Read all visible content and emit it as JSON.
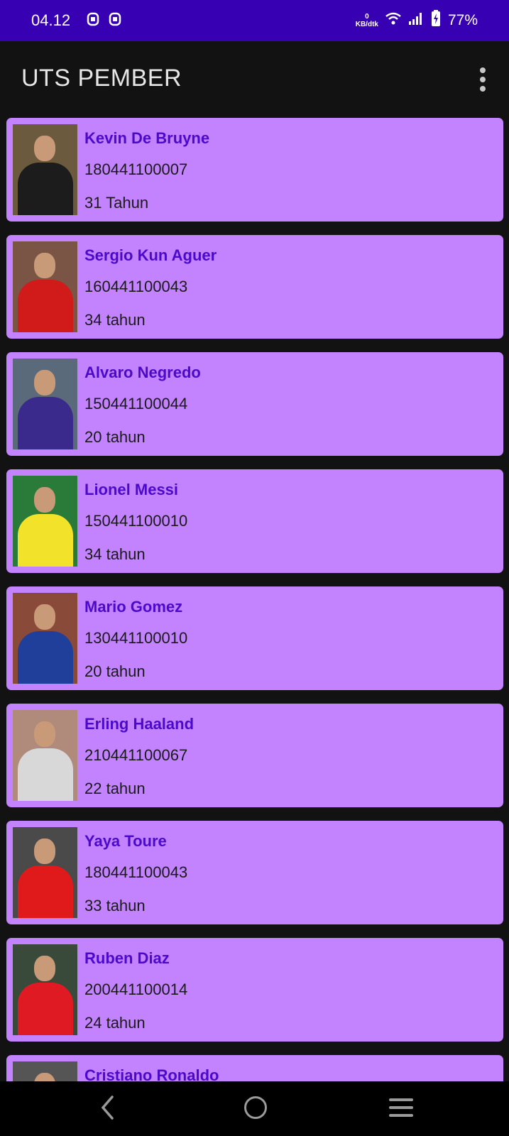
{
  "status_bar": {
    "time": "04.12",
    "notification_icons": [
      "notification-app-icon",
      "notification-app-icon"
    ],
    "network_speed_value": "0",
    "network_speed_unit": "KB/dtk",
    "battery": "77%",
    "bg_color": "#3700B3"
  },
  "app_bar": {
    "title": "UTS PEMBER",
    "menu_icon": "overflow-menu-icon"
  },
  "colors": {
    "card_bg": "#C383FE",
    "name_color": "#4B0ACB",
    "app_bg": "#121212"
  },
  "players": [
    {
      "name": "Kevin De Bruyne",
      "nim": "180441100007",
      "age": "31 Tahun",
      "kit": "#1c1c1c",
      "bg": "#6b5a3e"
    },
    {
      "name": "Sergio Kun Aguer",
      "nim": "160441100043",
      "age": "34 tahun",
      "kit": "#d11a1a",
      "bg": "#7a5545"
    },
    {
      "name": "Alvaro Negredo",
      "nim": "150441100044",
      "age": "20 tahun",
      "kit": "#3a2a8c",
      "bg": "#5a6a7a"
    },
    {
      "name": "Lionel Messi",
      "nim": "150441100010",
      "age": "34 tahun",
      "kit": "#f2e22a",
      "bg": "#2a7a3a"
    },
    {
      "name": "Mario Gomez",
      "nim": "130441100010",
      "age": "20 tahun",
      "kit": "#1f3f9a",
      "bg": "#8a4a3a"
    },
    {
      "name": "Erling Haaland",
      "nim": "210441100067",
      "age": "22 tahun",
      "kit": "#d8d8d8",
      "bg": "#b08a7a"
    },
    {
      "name": "Yaya Toure",
      "nim": "180441100043",
      "age": "33 tahun",
      "kit": "#e01a1a",
      "bg": "#4a4a4a"
    },
    {
      "name": "Ruben Diaz",
      "nim": "200441100014",
      "age": "24 tahun",
      "kit": "#e01a22",
      "bg": "#3a4a3a"
    },
    {
      "name": "Cristiano Ronaldo",
      "nim": "",
      "age": "",
      "kit": "#333333",
      "bg": "#555555"
    }
  ],
  "nav_bar": {
    "back_icon": "back-icon",
    "home_icon": "home-icon",
    "recents_icon": "recents-icon"
  }
}
